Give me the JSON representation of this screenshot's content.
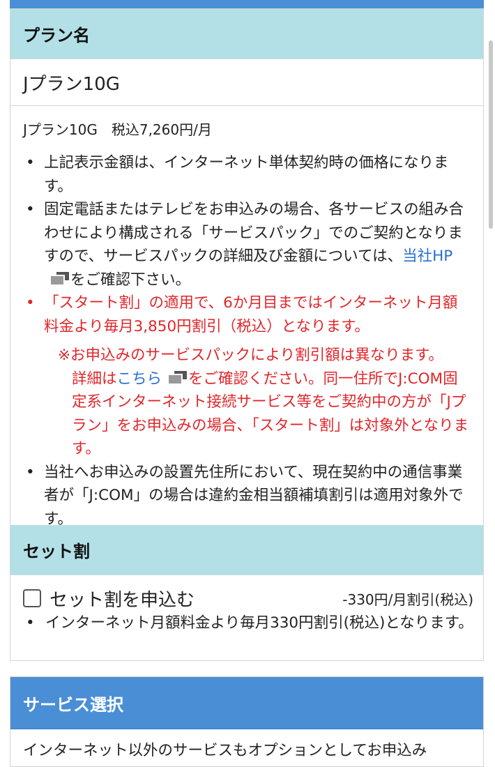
{
  "plan_section": {
    "heading": "プラン名",
    "plan_name": "Jプラン10G",
    "price_line": "Jプラン10G　税込7,260円/月",
    "notes": {
      "n1": "上記表示金額は、インターネット単体契約時の価格になります。",
      "n2_before_link": "固定電話またはテレビをお申込みの場合、各サービスの組み合わせにより構成される「サービスパック」でのご契約となりますので、サービスパックの詳細及び金額については、",
      "n2_link": "当社HP",
      "n2_after_link": "をご確認下さい。",
      "n3": "「スタート割」の適用で、6か月目まではインターネット月額料金より毎月3,850円割引（税込）となります。",
      "n4_line1": "※お申込みのサービスパックにより割引額は異なります。",
      "n4_before_link": "詳細は",
      "n4_link": "こちら",
      "n4_after_link": "をご確認ください。同一住所でJ:COM固定系インターネット接続サービス等をご契約中の方が「Jプラン」をお申込みの場合、「スタート割」は対象外となります。",
      "n5": "当社へお申込みの設置先住所において、現在契約中の通信事業者が「J:COM」の場合は違約金相当額補填割引は適用対象外です。"
    }
  },
  "set_discount": {
    "heading": "セット割",
    "checkbox_label": "セット割を申込む",
    "checked": false,
    "discount_text": "-330円/月割引(税込)",
    "note": "インターネット月額料金より毎月330円割引(税込)となります。"
  },
  "service_select": {
    "heading": "サービス選択",
    "text": "インターネット以外のサービスもオプションとしてお申込み"
  },
  "colors": {
    "section_header_bg": "#b2e0e6",
    "blue_header_bg": "#4a8fd6",
    "warning_red": "#e0262a",
    "link_blue": "#2a6fcf"
  },
  "icons": [
    "external-link-icon",
    "checkbox-icon"
  ]
}
